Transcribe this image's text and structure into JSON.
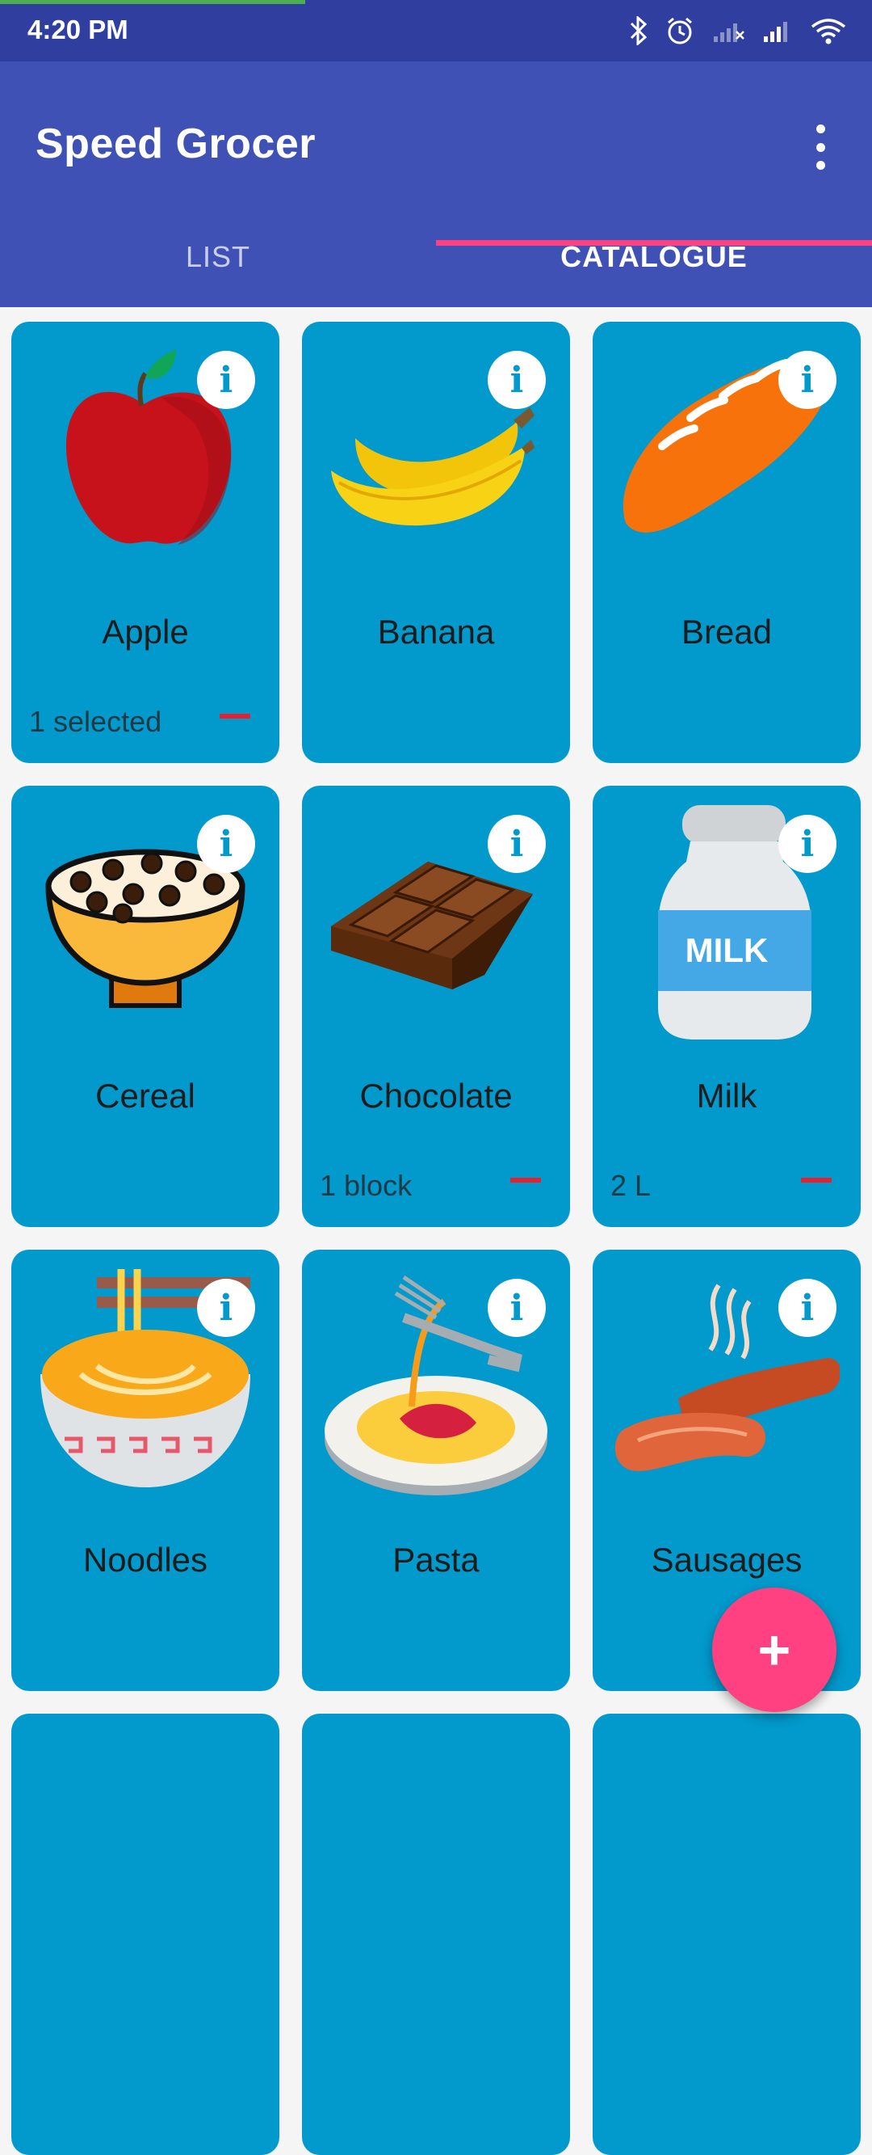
{
  "status": {
    "time": "4:20 PM"
  },
  "app": {
    "title": "Speed Grocer"
  },
  "tabs": [
    {
      "label": "LIST"
    },
    {
      "label": "CATALOGUE"
    }
  ],
  "cards": [
    {
      "name": "Apple",
      "qty": "1 selected",
      "icon": "apple-icon"
    },
    {
      "name": "Banana",
      "qty": "",
      "icon": "banana-icon"
    },
    {
      "name": "Bread",
      "qty": "",
      "icon": "bread-icon"
    },
    {
      "name": "Cereal",
      "qty": "",
      "icon": "cereal-icon"
    },
    {
      "name": "Chocolate",
      "qty": "1 block",
      "icon": "chocolate-icon"
    },
    {
      "name": "Milk",
      "qty": "2 L",
      "icon": "milk-icon",
      "label": "MILK"
    },
    {
      "name": "Noodles",
      "qty": "",
      "icon": "noodles-icon"
    },
    {
      "name": "Pasta",
      "qty": "",
      "icon": "pasta-icon"
    },
    {
      "name": "Sausages",
      "qty": "",
      "icon": "sausages-icon"
    }
  ],
  "fab": {
    "label": "+"
  },
  "colors": {
    "primary": "#3f51b5",
    "status": "#303f9f",
    "accent": "#ff4081",
    "card": "#0299cc"
  }
}
